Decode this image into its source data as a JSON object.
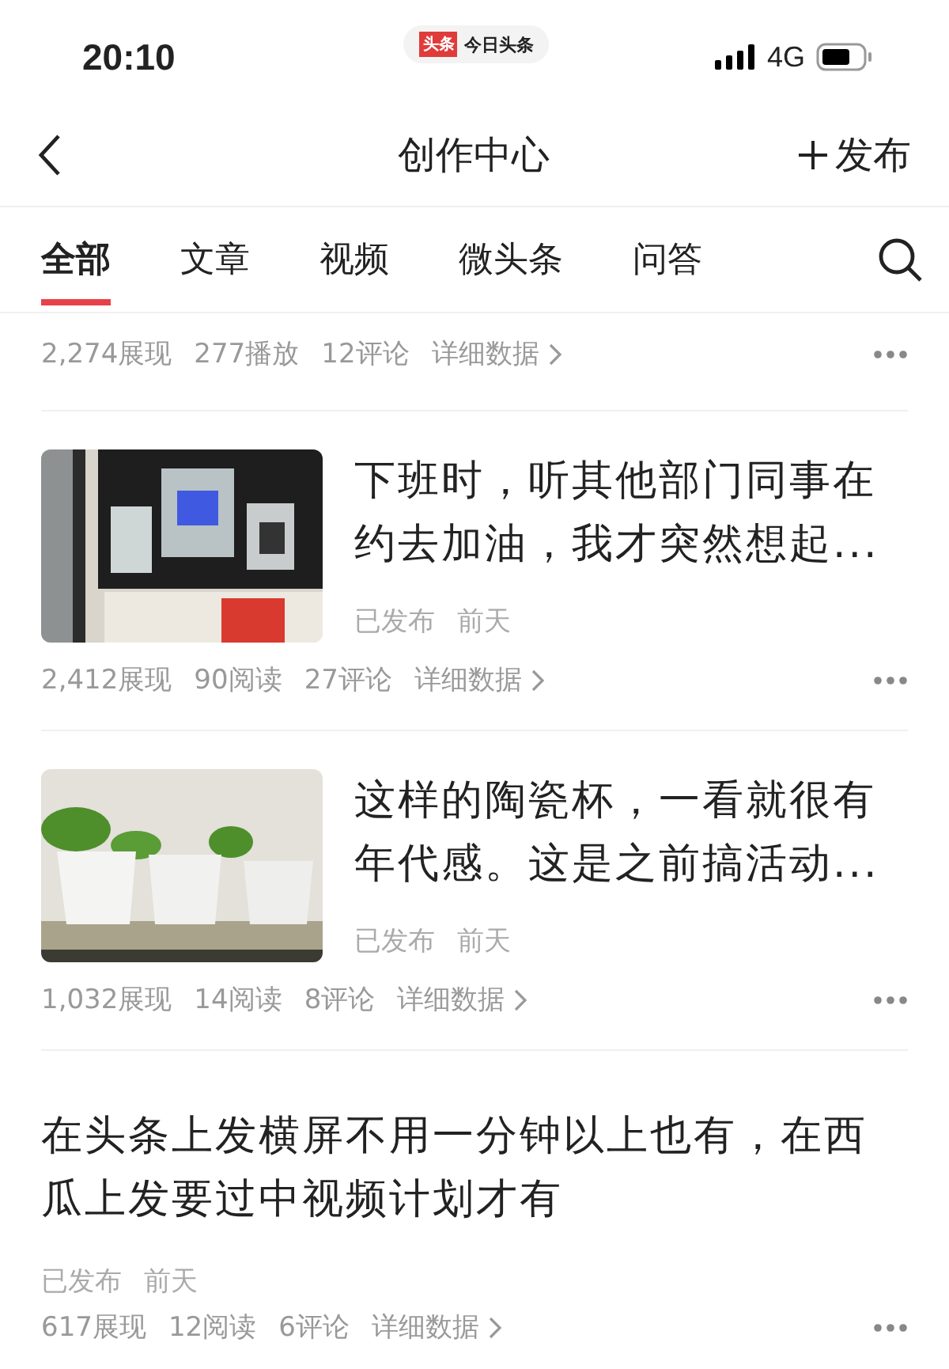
{
  "status_bar": {
    "time": "20:10",
    "app_badge": "头条",
    "app_name": "今日头条",
    "network": "4G"
  },
  "nav": {
    "title": "创作中心",
    "action": "发布"
  },
  "tabs": [
    {
      "label": "全部",
      "selected": true
    },
    {
      "label": "文章",
      "selected": false
    },
    {
      "label": "视频",
      "selected": false
    },
    {
      "label": "微头条",
      "selected": false
    },
    {
      "label": "问答",
      "selected": false
    }
  ],
  "articles": [
    {
      "kind": "stats_only",
      "stats": [
        "2,274展现",
        "277播放",
        "12评论"
      ],
      "details": "详细数据"
    },
    {
      "kind": "thumbnail",
      "title": "下班时，听其他部门同事在约去加油，我才突然想起...",
      "status": "已发布",
      "time": "前天",
      "stats": [
        "2,412展现",
        "90阅读",
        "27评论"
      ],
      "details": "详细数据"
    },
    {
      "kind": "thumbnail",
      "title": "这样的陶瓷杯，一看就很有年代感。这是之前搞活动...",
      "status": "已发布",
      "time": "前天",
      "stats": [
        "1,032展现",
        "14阅读",
        "8评论"
      ],
      "details": "详细数据"
    },
    {
      "kind": "text",
      "title": "在头条上发横屏不用一分钟以上也有，在西瓜上发要过中视频计划才有",
      "status": "已发布",
      "time": "前天",
      "stats": [
        "617展现",
        "12阅读",
        "6评论"
      ],
      "details": "详细数据"
    }
  ]
}
